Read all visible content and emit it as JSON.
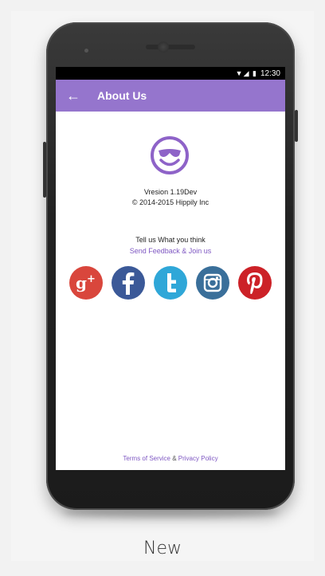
{
  "status_bar": {
    "time": "12:30",
    "icons": "▼◢ ▮"
  },
  "app_bar": {
    "back_icon": "←",
    "title": "About Us",
    "color": "#9575cd"
  },
  "about": {
    "logo_icon": "smiley-sunglasses-icon",
    "version": "Vresion 1.19Dev",
    "copyright": "© 2014-2015 Hippily Inc",
    "tell_us": "Tell us What you think",
    "feedback_link": "Send Feedback & Join us"
  },
  "social": [
    {
      "name": "google-plus",
      "glyph": "g+",
      "color": "#d9463c"
    },
    {
      "name": "facebook",
      "glyph": "f",
      "color": "#3b5998"
    },
    {
      "name": "twitter",
      "glyph": "t",
      "color": "#2fa7d8"
    },
    {
      "name": "instagram",
      "glyph": "",
      "color": "#3a6f9a"
    },
    {
      "name": "pinterest",
      "glyph": "P",
      "color": "#cc2127"
    }
  ],
  "footer": {
    "terms": "Terms of Service",
    "separator": " & ",
    "privacy": "Privacy Policy"
  },
  "caption": "New"
}
